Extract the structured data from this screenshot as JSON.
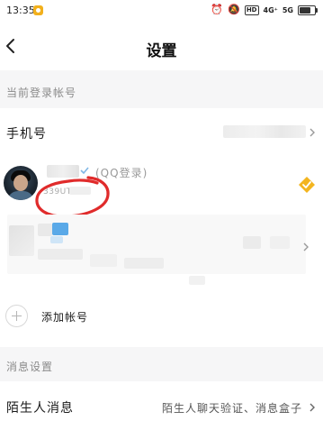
{
  "status_bar": {
    "time": "13:35",
    "signal_4g": "4G⁺",
    "signal_5g": "5G",
    "hd_label": "HD"
  },
  "nav": {
    "title": "设置"
  },
  "account_section": {
    "header": "当前登录帐号",
    "phone_label": "手机号",
    "current_account": {
      "login_tag": "(QQ登录)",
      "id_partial": "339UT"
    },
    "add_account_label": "添加帐号"
  },
  "message_section": {
    "header": "消息设置",
    "stranger_label": "陌生人消息",
    "stranger_value": "陌生人聊天验证、消息盒子"
  },
  "colors": {
    "accent_gold": "#f3b51f",
    "annotation_red": "#e02b2b",
    "section_bg": "#f6f6f7"
  }
}
